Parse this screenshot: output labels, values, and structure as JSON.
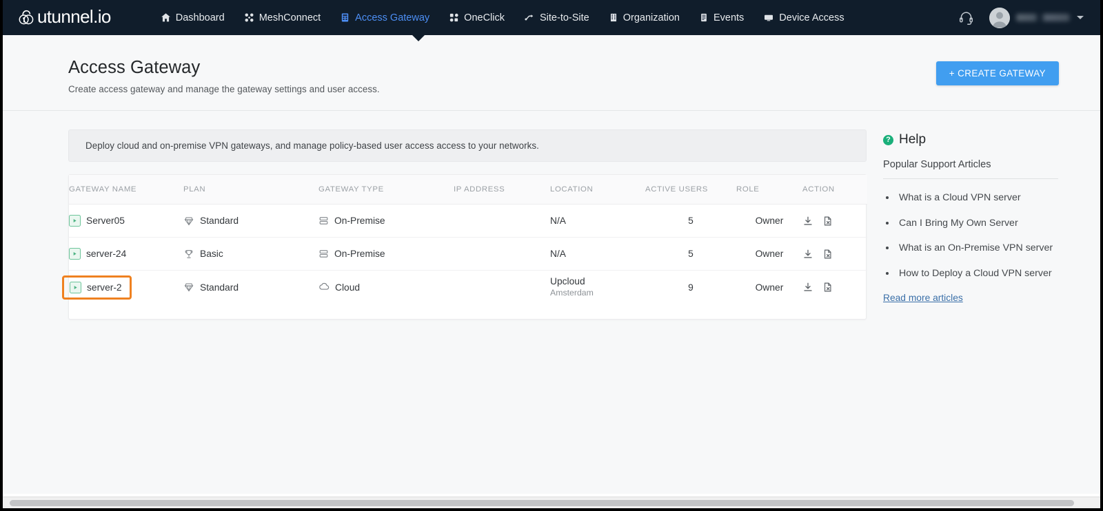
{
  "navbar": {
    "brand": "utunnel.io",
    "brand_logo_icon": "lock-shield-icon",
    "items": [
      {
        "label": "Dashboard",
        "icon": "home-icon",
        "active": false
      },
      {
        "label": "MeshConnect",
        "icon": "mesh-nodes-icon",
        "active": false
      },
      {
        "label": "Access Gateway",
        "icon": "gateway-icon",
        "active": true
      },
      {
        "label": "OneClick",
        "icon": "oneclick-icon",
        "active": false
      },
      {
        "label": "Site-to-Site",
        "icon": "site-to-site-icon",
        "active": false
      },
      {
        "label": "Organization",
        "icon": "building-icon",
        "active": false
      },
      {
        "label": "Events",
        "icon": "events-list-icon",
        "active": false
      },
      {
        "label": "Device Access",
        "icon": "monitor-icon",
        "active": false
      }
    ],
    "support_icon": "headset-icon",
    "user_name": "",
    "user_avatar_icon": "user-avatar-icon",
    "user_caret_icon": "chevron-down-icon",
    "active_color": "#4d8ff5",
    "background_color": "#101d2b"
  },
  "header": {
    "title": "Access Gateway",
    "subtitle": "Create access gateway and manage the gateway settings and user access.",
    "create_button": "+ CREATE GATEWAY",
    "create_button_color": "#419ef0"
  },
  "banner": {
    "text": "Deploy cloud and on-premise VPN gateways, and manage policy-based user access access to your networks."
  },
  "table": {
    "columns": [
      "GATEWAY NAME",
      "PLAN",
      "GATEWAY TYPE",
      "IP ADDRESS",
      "LOCATION",
      "ACTIVE USERS",
      "ROLE",
      "ACTION"
    ],
    "rows": [
      {
        "status_icon": "running-play-icon",
        "name": "Server05",
        "highlighted": false,
        "plan": "Standard",
        "plan_icon": "gem-icon",
        "gateway_type": "On-Premise",
        "gateway_type_icon": "server-stack-icon",
        "ip_address": "",
        "ip_masked": true,
        "location": "N/A",
        "location_sub": "",
        "active_users": "5",
        "role": "Owner",
        "actions": [
          "download-icon",
          "file-remove-icon"
        ]
      },
      {
        "status_icon": "running-play-icon",
        "name": "server-24",
        "highlighted": false,
        "plan": "Basic",
        "plan_icon": "trophy-icon",
        "gateway_type": "On-Premise",
        "gateway_type_icon": "server-stack-icon",
        "ip_address": "",
        "ip_masked": true,
        "location": "N/A",
        "location_sub": "",
        "active_users": "5",
        "role": "Owner",
        "actions": [
          "download-icon",
          "file-remove-icon"
        ]
      },
      {
        "status_icon": "running-play-icon",
        "name": "server-2",
        "highlighted": true,
        "highlight_color": "#ef8120",
        "plan": "Standard",
        "plan_icon": "gem-icon",
        "gateway_type": "Cloud",
        "gateway_type_icon": "cloud-icon",
        "ip_address": "",
        "ip_masked": true,
        "location": "Upcloud",
        "location_sub": "Amsterdam",
        "active_users": "9",
        "role": "Owner",
        "actions": [
          "download-icon",
          "file-remove-icon"
        ]
      }
    ]
  },
  "help": {
    "icon": "question-circle-icon",
    "title": "Help",
    "subtitle": "Popular Support Articles",
    "articles": [
      "What is a Cloud VPN server",
      "Can I Bring My Own Server",
      "What is an On-Premise VPN server",
      "How to Deploy a Cloud VPN server"
    ],
    "read_more": "Read more articles",
    "link_color": "#3a6fa8"
  }
}
